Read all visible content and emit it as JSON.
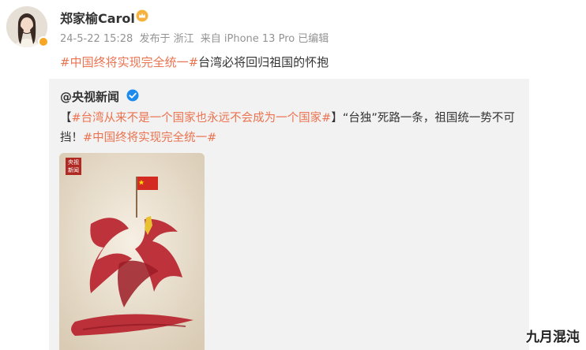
{
  "post": {
    "author": "郑家榆Carol",
    "timestamp": "24-5-22 15:28",
    "publish_location": "发布于 浙江",
    "device": "来自 iPhone 13 Pro",
    "edited": "已编辑",
    "hashtag": "#中国终将实现完全统一#",
    "text": "台湾必将回归祖国的怀抱"
  },
  "repost": {
    "author": "@央视新闻",
    "bracket_open": "【",
    "hashtag1": "#台湾从来不是一个国家也永远不会成为一个国家#",
    "bracket_close": "】",
    "text": "“台独”死路一条，祖国统一势不可挡！",
    "hashtag2": "#中国终将实现完全统一#"
  },
  "poster": {
    "logo_line1": "央视",
    "logo_line2": "新闻"
  },
  "watermark": "九月混沌",
  "colors": {
    "hashtag": "#eb7350",
    "repost_bg": "#f2f2f2",
    "verified_blue": "#1c8bf0",
    "poster_red": "#b8232e"
  }
}
